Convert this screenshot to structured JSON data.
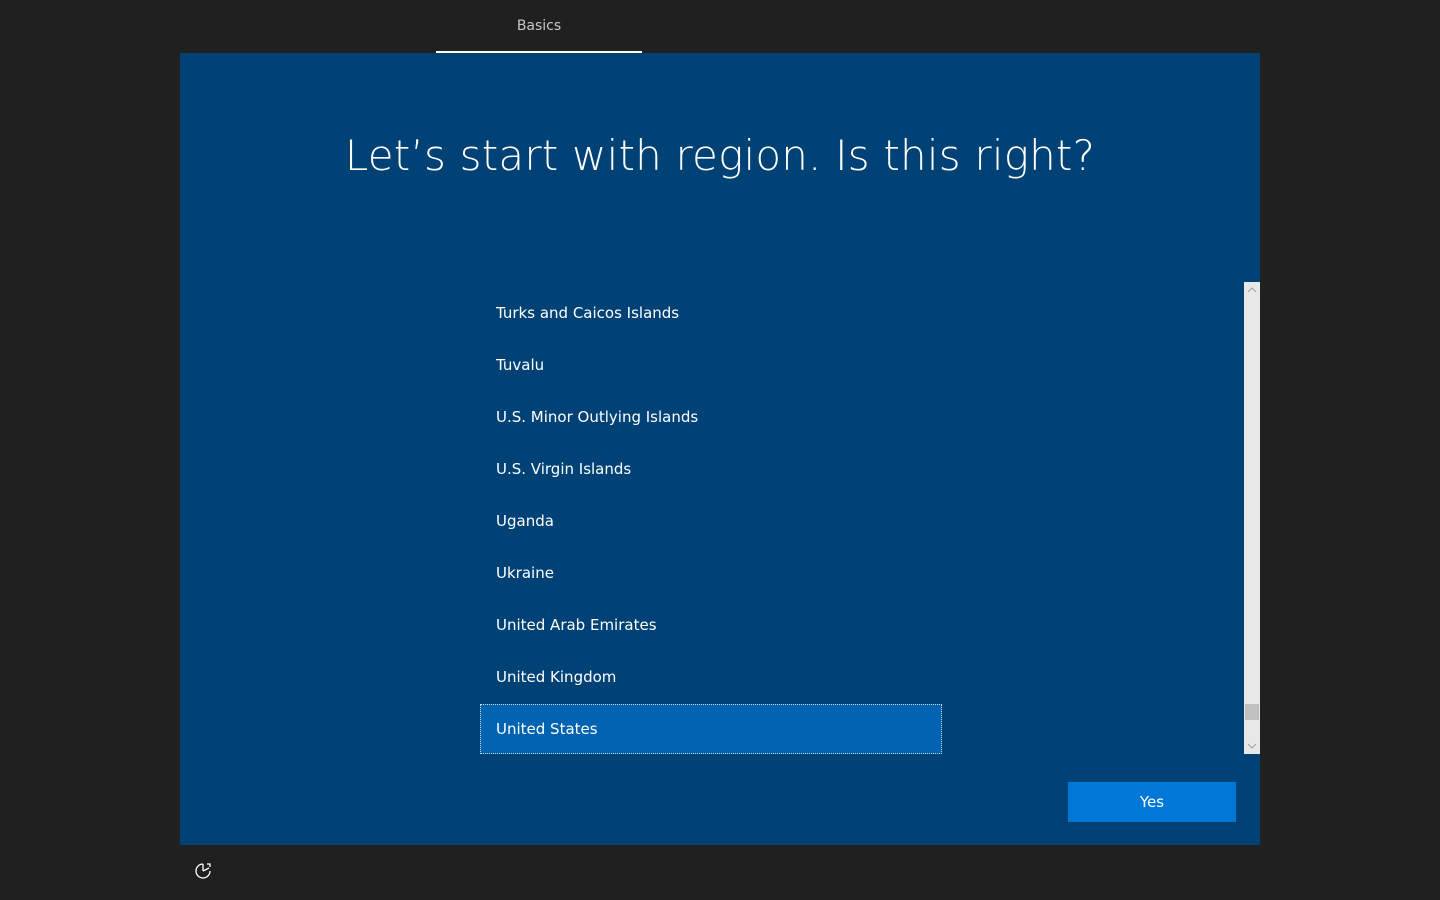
{
  "header": {
    "tab_label": "Basics"
  },
  "main": {
    "title": "Let’s start with region. Is this right?",
    "regions": [
      "Turks and Caicos Islands",
      "Tuvalu",
      "U.S. Minor Outlying Islands",
      "U.S. Virgin Islands",
      "Uganda",
      "Ukraine",
      "United Arab Emirates",
      "United Kingdom",
      "United States"
    ],
    "selected_region": "United States",
    "yes_label": "Yes"
  },
  "footer": {
    "ease_of_access_icon": "ease-of-access-icon"
  },
  "colors": {
    "background": "#202020",
    "panel": "#004275",
    "selected": "#0063b1",
    "button": "#0078d7"
  }
}
